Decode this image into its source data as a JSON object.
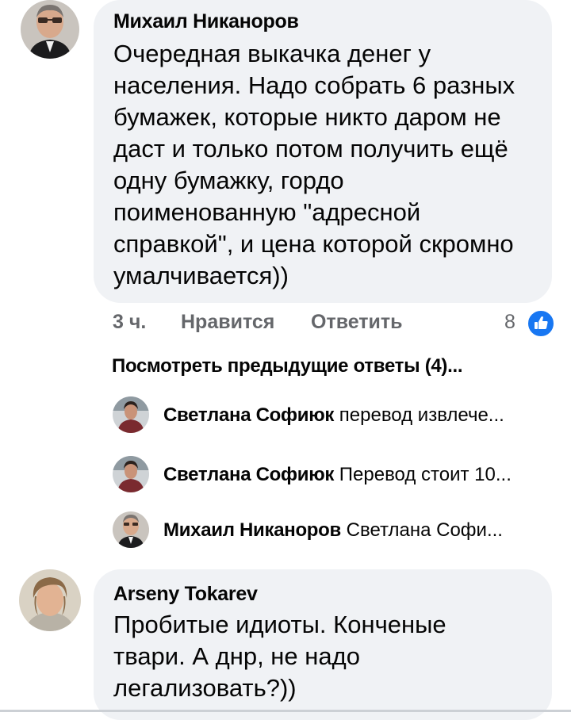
{
  "comment1": {
    "author": "Михаил Никаноров",
    "lines": [
      "Очередная выкачка денег у",
      "населения. Надо собрать 6 разных",
      "бумажек, которые никто даром не",
      "даст и только потом получить ещё",
      "одну бумажку, гордо",
      "поименованную \"адресной",
      "справкой\", и цена которой скромно",
      "умалчивается))"
    ],
    "time": "3 ч.",
    "like_label": "Нравится",
    "reply_label": "Ответить",
    "reaction_count": "8",
    "reaction_icon": "like-thumb-icon",
    "view_previous": "Посмотреть предыдущие ответы (4)..."
  },
  "replies": [
    {
      "author": "Светлана Софиюк",
      "text": "перевод извлече..."
    },
    {
      "author": "Светлана Софиюк",
      "text": "Перевод стоит 10..."
    },
    {
      "author": "Михаил Никаноров",
      "text": "Светлана Софи..."
    }
  ],
  "comment2": {
    "author": "Arseny Tokarev",
    "lines": [
      "Пробитые идиоты. Конченые",
      "твари. А днр, не надо",
      "легализовать?))"
    ]
  },
  "colors": {
    "bubble": "#f0f2f5",
    "secondary_text": "#65676b",
    "like_blue": "#1877f2"
  }
}
